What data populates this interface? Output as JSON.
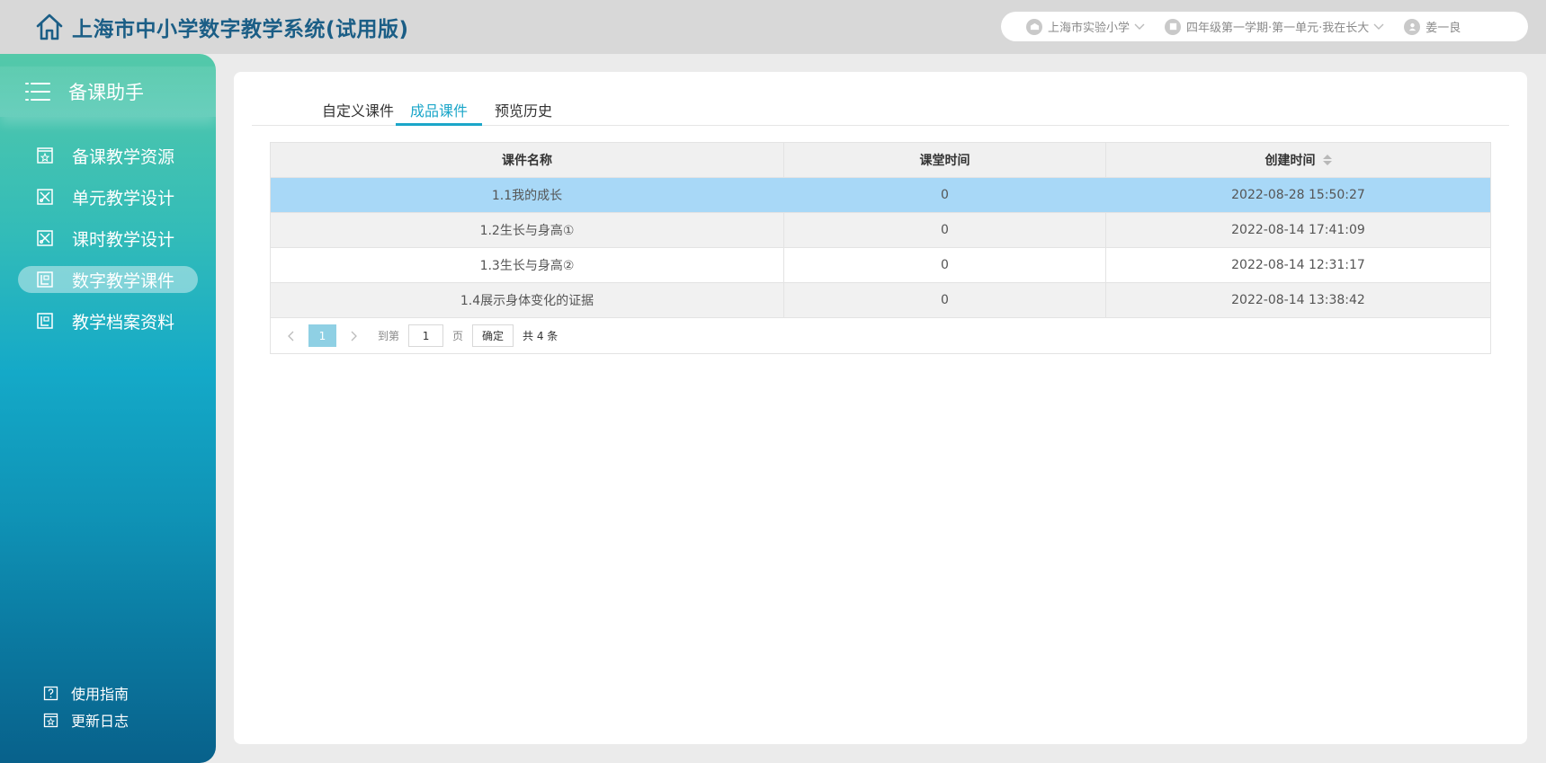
{
  "header": {
    "title": "上海市中小学数字教学系统(试用版)",
    "school": "上海市实验小学",
    "unit": "四年级第一学期·第一单元·我在长大",
    "user": "姜一良"
  },
  "sidebar": {
    "title": "备课助手",
    "items": [
      {
        "label": "备课教学资源",
        "icon": "star-card-icon"
      },
      {
        "label": "单元教学设计",
        "icon": "tools-icon"
      },
      {
        "label": "课时教学设计",
        "icon": "tools-icon"
      },
      {
        "label": "数字教学课件",
        "icon": "courseware-icon"
      },
      {
        "label": "教学档案资料",
        "icon": "archive-icon"
      }
    ],
    "active_index": 3,
    "footer": [
      {
        "label": "使用指南",
        "icon": "question-icon"
      },
      {
        "label": "更新日志",
        "icon": "log-icon"
      }
    ]
  },
  "tabs": [
    {
      "label": "自定义课件"
    },
    {
      "label": "成品课件"
    },
    {
      "label": "预览历史"
    }
  ],
  "active_tab": 1,
  "table": {
    "columns": [
      "课件名称",
      "课堂时间",
      "创建时间"
    ],
    "rows": [
      {
        "name": "1.1我的成长",
        "time": "0",
        "created": "2022-08-28 15:50:27"
      },
      {
        "name": "1.2生长与身高①",
        "time": "0",
        "created": "2022-08-14 17:41:09"
      },
      {
        "name": "1.3生长与身高②",
        "time": "0",
        "created": "2022-08-14 12:31:17"
      },
      {
        "name": "1.4展示身体变化的证据",
        "time": "0",
        "created": "2022-08-14 13:38:42"
      }
    ]
  },
  "pager": {
    "current": "1",
    "goto_label": "到第",
    "goto_value": "1",
    "page_label": "页",
    "confirm_label": "确定",
    "total": "共 4 条"
  },
  "colors": {
    "accent": "#1ba6c9",
    "brand_title": "#1b5e86",
    "selected_row": "#a8d8f7"
  }
}
